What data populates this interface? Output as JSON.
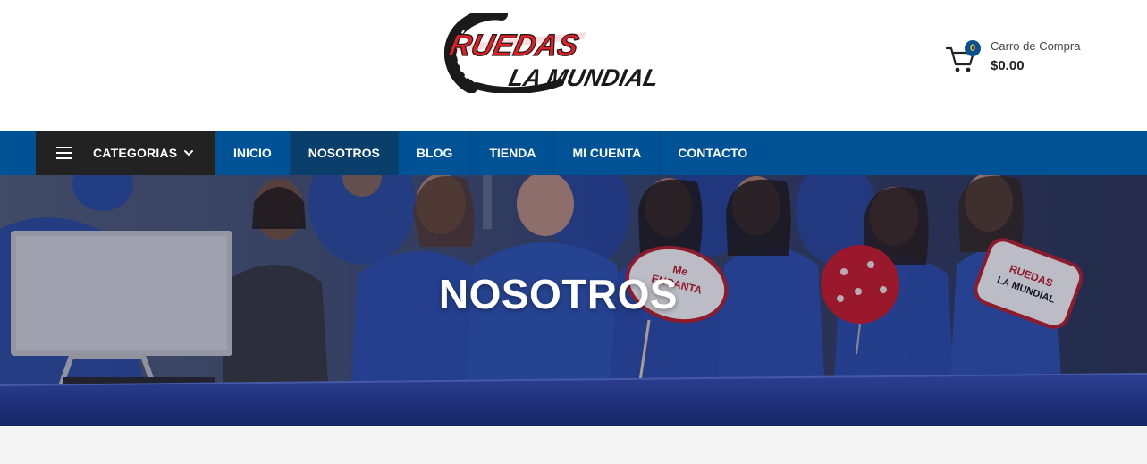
{
  "header": {
    "logo": {
      "line1": "RUEDAS",
      "line2": "LA MUNDIAL"
    },
    "cart": {
      "icon": "shopping-cart-icon",
      "count": "0",
      "label": "Carro de Compra",
      "total": "$0.00"
    }
  },
  "nav": {
    "categories": {
      "icon": "hamburger-icon",
      "label": "CATEGORIAS",
      "chevron": "chevron-down-icon"
    },
    "items": [
      {
        "label": "INICIO",
        "active": false
      },
      {
        "label": "NOSOTROS",
        "active": true
      },
      {
        "label": "BLOG",
        "active": false
      },
      {
        "label": "TIENDA",
        "active": false
      },
      {
        "label": "MI CUENTA",
        "active": false
      },
      {
        "label": "CONTACTO",
        "active": false
      }
    ]
  },
  "hero": {
    "title": "NOSOTROS",
    "signs": {
      "left_sign_line1": "Me",
      "left_sign_line2": "ENCANTA",
      "right_sign_line1": "RUEDAS",
      "right_sign_line2": "LA MUNDIAL"
    }
  },
  "colors": {
    "nav_background": "#005296",
    "nav_active": "#0b3f6b",
    "categories_background": "#222222",
    "brand_red": "#e01f26",
    "brand_black": "#1a1a1a",
    "cart_badge": "#0b5091",
    "content_background": "#f4f4f4"
  }
}
